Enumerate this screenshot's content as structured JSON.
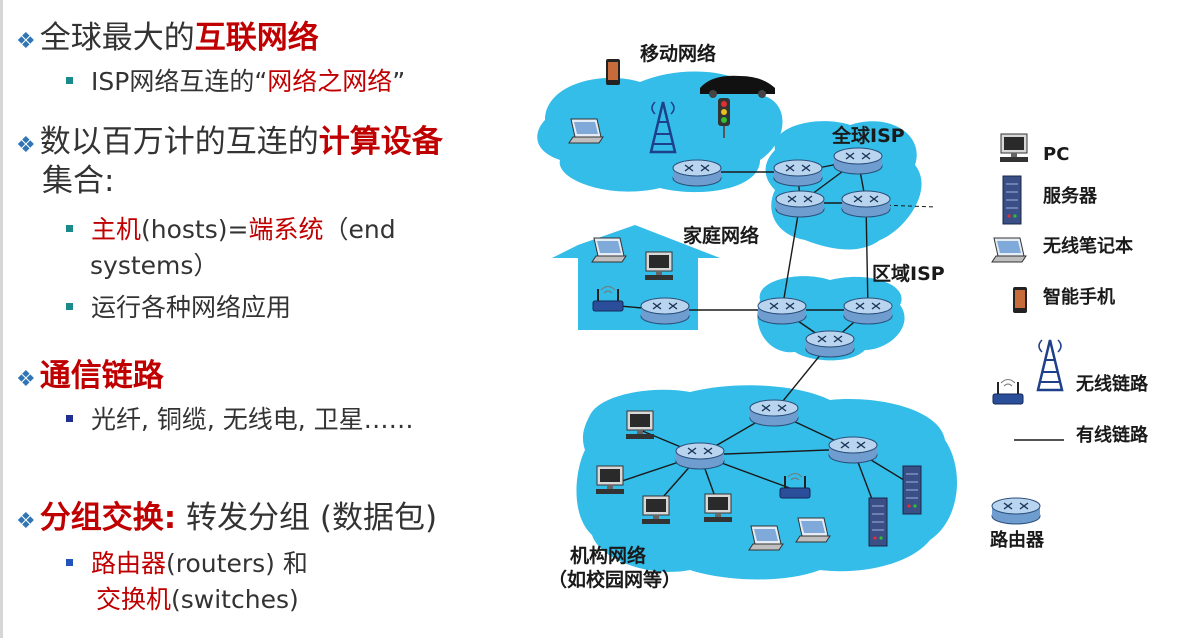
{
  "bullets": {
    "b1": {
      "prefix": "全球最大的",
      "highlight": "互联网络"
    },
    "b1_sub": {
      "prefix": "ISP网络互连的",
      "quote_open": "“",
      "highlight": "网络之网络",
      "quote_close": "”"
    },
    "b2": {
      "prefix": "数以百万计的互连的",
      "highlight": "计算设备",
      "cont": "集合:"
    },
    "b2_sub1": {
      "p1": "主机",
      "p2": "(hosts)=",
      "p3": "端系统",
      "p4": "（end",
      "cont": "systems）"
    },
    "b2_sub2": {
      "text": "运行各种网络应用"
    },
    "b3": {
      "highlight": "通信链路"
    },
    "b3_sub": {
      "text": "光纤, 铜缆, 无线电, 卫星……"
    },
    "b4": {
      "highlight": "分组交换:",
      "rest": " 转发分组 (数据包)"
    },
    "b4_sub": {
      "p1": "路由器",
      "p2": "(routers) 和",
      "p3": "交换机",
      "p4": "(switches)"
    }
  },
  "diagram": {
    "mobile_label": "移动网络",
    "global_isp_label": "全球ISP",
    "home_label": "家庭网络",
    "regional_label": "区域ISP",
    "inst_label1": "机构网络",
    "inst_label2": "（如校园网等）"
  },
  "legend": {
    "pc": "PC",
    "server": "服务器",
    "laptop": "无线笔记本",
    "phone": "智能手机",
    "wireless": "无线链路",
    "wired": "有线链路",
    "router": "路由器"
  },
  "colors": {
    "cloud": "#33bde8",
    "accent_red": "#c00000",
    "diamond": "#2e75b6",
    "router": "#9fc3e6"
  }
}
